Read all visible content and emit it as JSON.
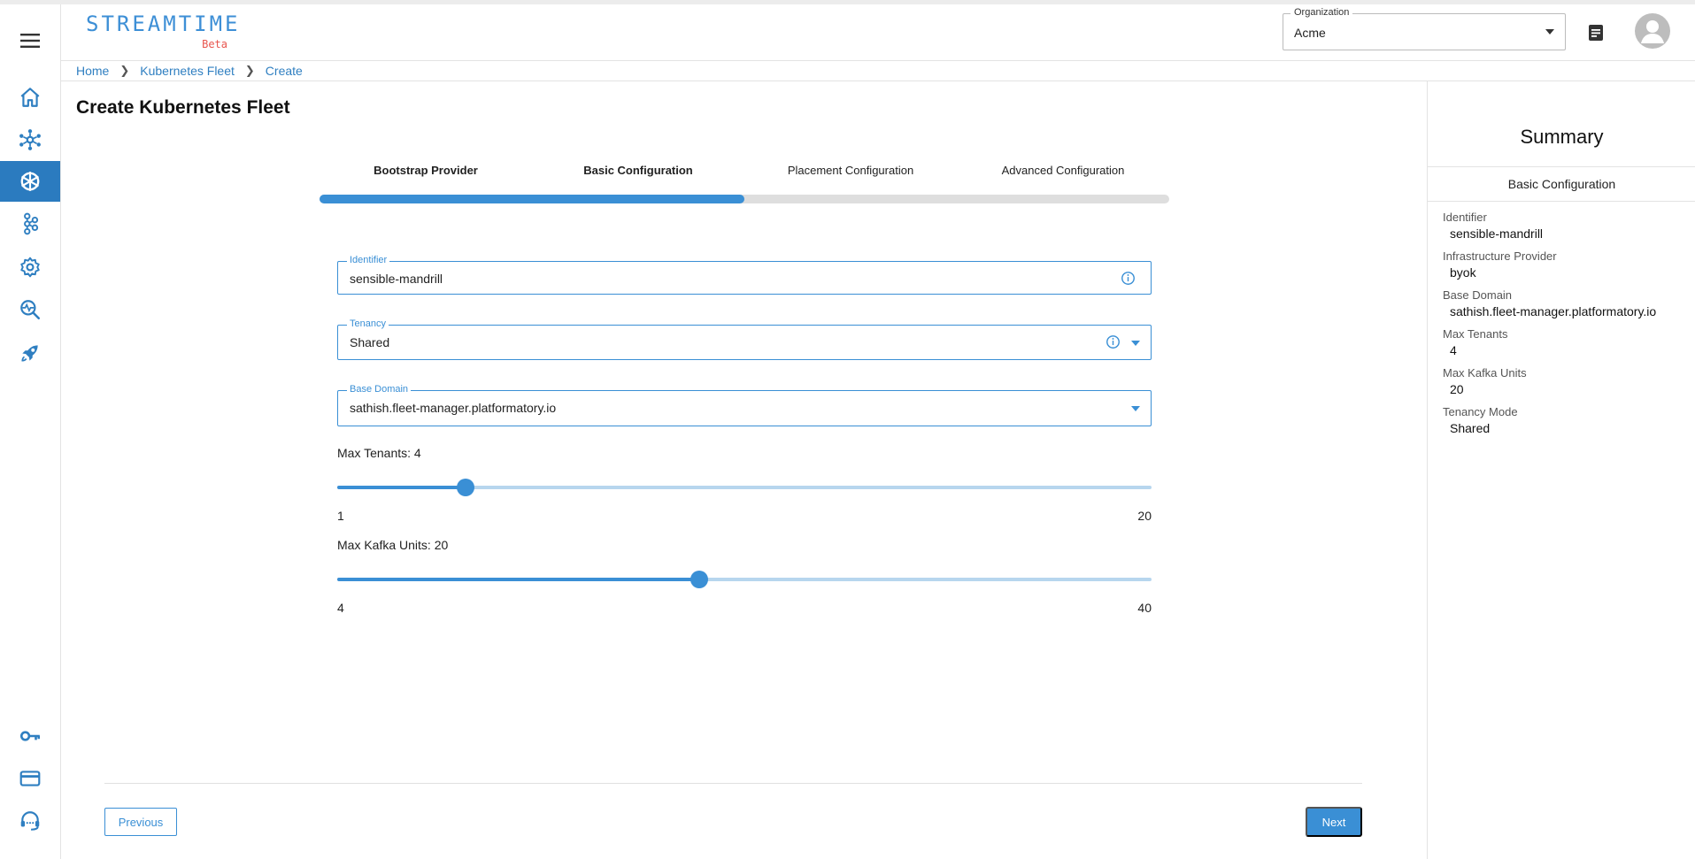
{
  "header": {
    "logo_text": "STREAMTIME",
    "logo_badge": "Beta",
    "organization_label": "Organization",
    "organization_value": "Acme"
  },
  "breadcrumb": [
    "Home",
    "Kubernetes Fleet",
    "Create"
  ],
  "page_title": "Create Kubernetes Fleet",
  "stepper": {
    "steps": [
      "Bootstrap Provider",
      "Basic Configuration",
      "Placement Configuration",
      "Advanced Configuration"
    ],
    "active_index": 1,
    "progress_fraction": 0.5
  },
  "form": {
    "identifier": {
      "label": "Identifier",
      "value": "sensible-mandrill"
    },
    "tenancy": {
      "label": "Tenancy",
      "value": "Shared"
    },
    "base_domain": {
      "label": "Base Domain",
      "value": "sathish.fleet-manager.platformatory.io"
    },
    "max_tenants": {
      "label": "Max Tenants: 4",
      "min": 1,
      "max": 20,
      "value": 4,
      "min_label": "1",
      "max_label": "20"
    },
    "max_kafka_units": {
      "label": "Max Kafka Units: 20",
      "min": 4,
      "max": 40,
      "value": 20,
      "min_label": "4",
      "max_label": "40"
    }
  },
  "buttons": {
    "previous": "Previous",
    "next": "Next"
  },
  "summary": {
    "title": "Summary",
    "section": "Basic Configuration",
    "items": [
      {
        "key": "Identifier",
        "value": "sensible-mandrill"
      },
      {
        "key": "Infrastructure Provider",
        "value": "byok"
      },
      {
        "key": "Base Domain",
        "value": "sathish.fleet-manager.platformatory.io"
      },
      {
        "key": "Max Tenants",
        "value": "4"
      },
      {
        "key": "Max Kafka Units",
        "value": "20"
      },
      {
        "key": "Tenancy Mode",
        "value": "Shared"
      }
    ]
  },
  "nav_icons": [
    "home-icon",
    "network-icon",
    "kubernetes-icon",
    "cluster-icon",
    "settings-icon",
    "monitoring-icon",
    "rocket-icon",
    "key-icon",
    "credit-card-icon",
    "support-icon"
  ],
  "colors": {
    "accent": "#3a8fd5",
    "active_nav": "#2b7bbf",
    "slider_rail": "#b7d6ee",
    "logo_badge": "#e8554e"
  }
}
